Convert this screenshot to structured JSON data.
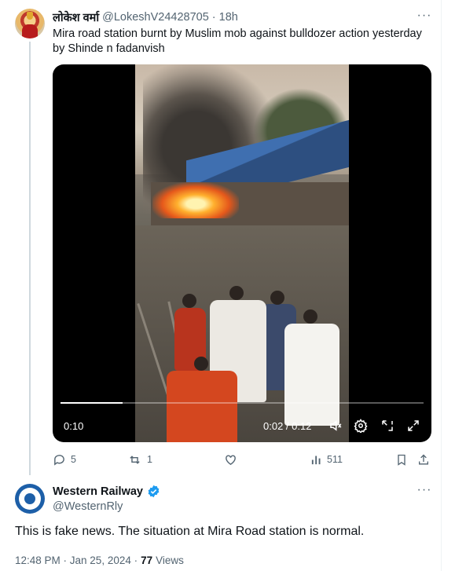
{
  "parent_tweet": {
    "author_name": "लोकेश वर्मा",
    "author_handle": "@LokeshV24428705",
    "separator": "·",
    "time": "18h",
    "text": "Mira road station burnt by Muslim mob against bulldozer action yesterday by Shinde n fadanvish",
    "more": "···",
    "video": {
      "view_count": "0:10",
      "time_display": "0:02 / 0:12",
      "progress": 0.17
    },
    "actions": {
      "replies": "5",
      "reposts": "1",
      "likes": "",
      "views": "511"
    }
  },
  "reply_tweet": {
    "author_name": "Western Railway",
    "author_handle": "@WesternRly",
    "verified": true,
    "more": "···",
    "text": "This is fake news. The situation at Mira Road station is normal.",
    "timestamp": "12:48 PM · Jan 25, 2024 ·",
    "views_count": "77",
    "views_label": "Views"
  },
  "colors": {
    "text": "#0f1419",
    "secondary": "#536471",
    "verified": "#1d9bf0",
    "line": "#cfd9de"
  }
}
